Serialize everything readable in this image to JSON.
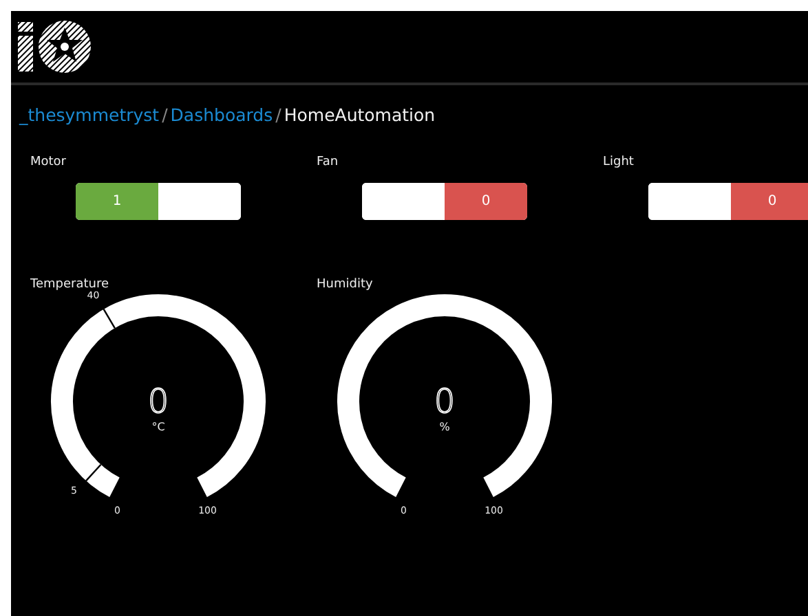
{
  "breadcrumb": [
    {
      "label": "_thesymmetryst",
      "kind": "link"
    },
    {
      "label": "Dashboards",
      "kind": "link"
    },
    {
      "label": "HomeAutomation",
      "kind": "current"
    }
  ],
  "separator": "/",
  "toggles": [
    {
      "label": "Motor",
      "on": true,
      "value": "1"
    },
    {
      "label": "Fan",
      "on": false,
      "value": "0"
    },
    {
      "label": "Light",
      "on": false,
      "value": "0"
    }
  ],
  "gauges": [
    {
      "label": "Temperature",
      "value": "0",
      "unit": "°C",
      "min": "0",
      "max": "100",
      "ticks": [
        "5",
        "40"
      ]
    },
    {
      "label": "Humidity",
      "value": "0",
      "unit": "%",
      "min": "0",
      "max": "100"
    }
  ]
}
